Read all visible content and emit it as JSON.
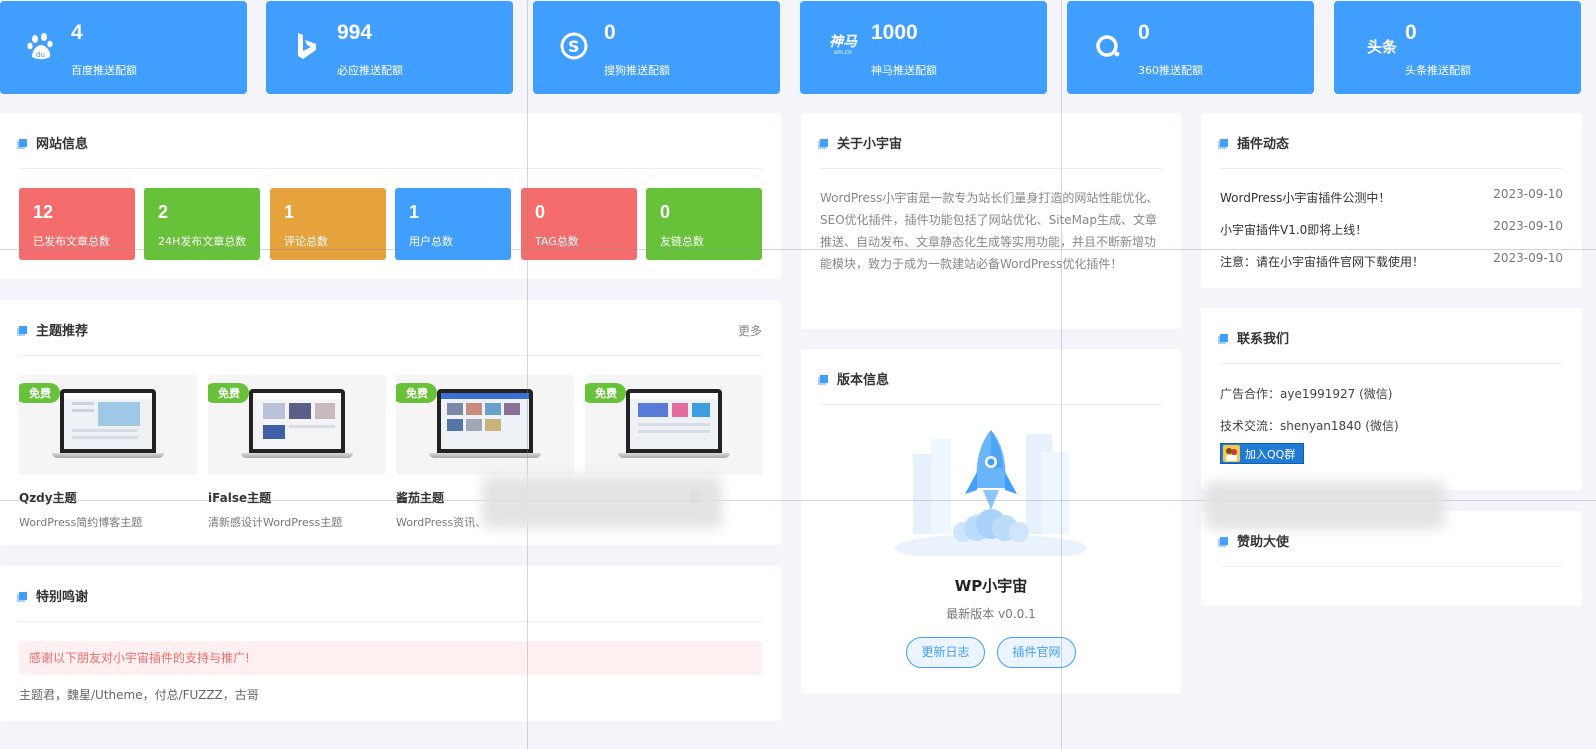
{
  "quotas": [
    {
      "icon": "baidu-paw-icon",
      "value": "4",
      "label": "百度推送配额"
    },
    {
      "icon": "bing-icon",
      "value": "994",
      "label": "必应推送配额"
    },
    {
      "icon": "sogou-icon",
      "value": "0",
      "label": "搜狗推送配额"
    },
    {
      "icon": "shenma-icon",
      "icon_text": "神马",
      "icon_sub": "sm.cn",
      "value": "1000",
      "label": "神马推送配额"
    },
    {
      "icon": "so360-icon",
      "value": "0",
      "label": "360推送配额"
    },
    {
      "icon": "toutiao-icon",
      "icon_text": "头条",
      "value": "0",
      "label": "头条推送配额"
    }
  ],
  "site_info": {
    "title": "网站信息",
    "stats": [
      {
        "value": "12",
        "label": "已发布文章总数",
        "color": "#f56c6c"
      },
      {
        "value": "2",
        "label": "24H发布文章总数",
        "color": "#67c23a"
      },
      {
        "value": "1",
        "label": "评论总数",
        "color": "#e6a23c"
      },
      {
        "value": "1",
        "label": "用户总数",
        "color": "#409eff"
      },
      {
        "value": "0",
        "label": "TAG总数",
        "color": "#f56c6c"
      },
      {
        "value": "0",
        "label": "友链总数",
        "color": "#67c23a"
      }
    ]
  },
  "themes": {
    "title": "主题推荐",
    "more": "更多",
    "items": [
      {
        "badge": "免费",
        "name": "Qzdy主题",
        "desc": "WordPress简约博客主题"
      },
      {
        "badge": "免费",
        "name": "iFalse主题",
        "desc": "清新感设计WordPress主题"
      },
      {
        "badge": "免费",
        "name": "酱茄主题",
        "desc": "WordPress资讯、"
      },
      {
        "badge": "免费",
        "name": "",
        "desc": "题"
      }
    ]
  },
  "thanks": {
    "title": "特别鸣谢",
    "notice": "感谢以下朋友对小宇宙插件的支持与推广!",
    "names": "主题君，魏星/Utheme，付总/FUZZZ，古哥"
  },
  "about": {
    "title": "关于小宇宙",
    "text": "WordPress小宇宙是一款专为站长们量身打造的网站性能优化、SEO优化插件，插件功能包括了网站优化、SiteMap生成、文章推送、自动发布、文章静态化生成等实用功能，并且不断新增功能模块，致力于成为一款建站必备WordPress优化插件！"
  },
  "version": {
    "title": "版本信息",
    "name": "WP小宇宙",
    "latest": "最新版本 v0.0.1",
    "changelog_btn": "更新日志",
    "site_btn": "插件官网"
  },
  "news": {
    "title": "插件动态",
    "items": [
      {
        "text": "WordPress小宇宙插件公测中！",
        "date": "2023-09-10"
      },
      {
        "text": "小宇宙插件V1.0即将上线！",
        "date": "2023-09-10"
      },
      {
        "text": "注意：请在小宇宙插件官网下载使用！",
        "date": "2023-09-10"
      }
    ]
  },
  "contact": {
    "title": "联系我们",
    "ad": "广告合作：aye1991927 (微信)",
    "tech": "技术交流：shenyan1840 (微信)",
    "qq_btn": "加入QQ群"
  },
  "sponsor": {
    "title": "赞助大使"
  },
  "colors": {
    "accent": "#409eff",
    "green": "#67c23a",
    "red": "#f56c6c",
    "orange": "#e6a23c"
  }
}
